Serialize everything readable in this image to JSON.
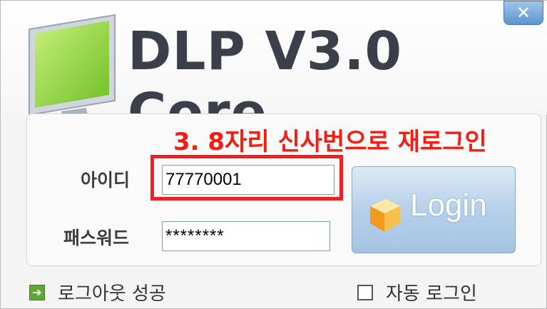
{
  "window": {
    "title": "DLP V3.0 Core",
    "close_label": "✕"
  },
  "annotation": {
    "instruction": "3. 8자리 신사번으로 재로그인"
  },
  "login_form": {
    "id_label": "아이디",
    "id_value": "77770001",
    "password_label": "패스워드",
    "password_value": "********",
    "login_button_label": "Login"
  },
  "footer": {
    "status_text": "로그아웃 성공",
    "auto_login_label": "자동 로그인",
    "auto_login_checked": false
  },
  "colors": {
    "annotation_red": "#ef2020",
    "title_dark": "#3a3f4a",
    "login_blue": "#b6d0e9"
  }
}
